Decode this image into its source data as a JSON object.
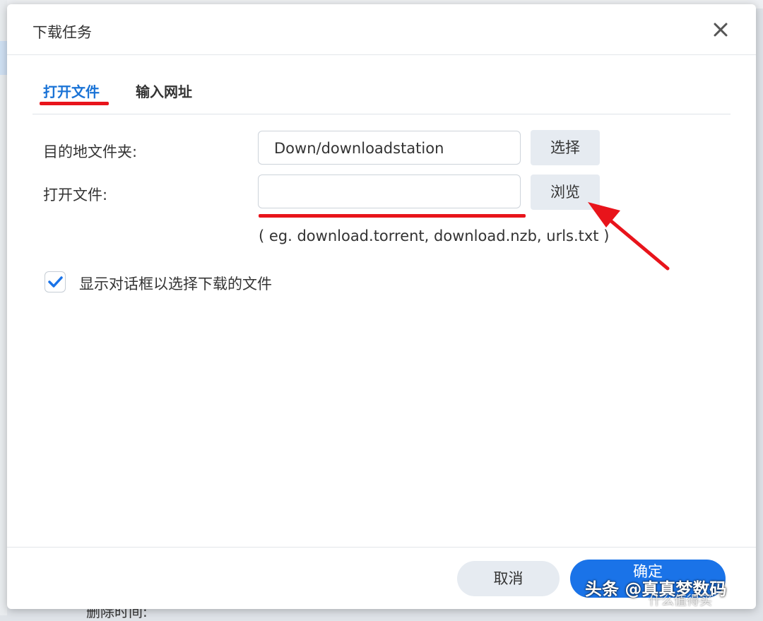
{
  "dialog": {
    "title": "下载任务",
    "close_icon": "close-icon"
  },
  "tabs": [
    {
      "label": "打开文件",
      "active": true
    },
    {
      "label": "输入网址",
      "active": false
    }
  ],
  "form": {
    "destination_label": "目的地文件夹:",
    "destination_value": "Down/downloadstation",
    "select_button": "选择",
    "open_file_label": "打开文件:",
    "open_file_value": "",
    "browse_button": "浏览",
    "hint": "( eg. download.torrent, download.nzb, urls.txt )"
  },
  "checkbox": {
    "label": "显示对话框以选择下载的文件",
    "checked": true
  },
  "footer": {
    "cancel_button": "取消",
    "ok_button": "确定"
  },
  "background": {
    "partial_text": "删除时间:"
  },
  "watermark": {
    "text": "头条 @真真梦数码",
    "sub_text": "什么值得买"
  },
  "colors": {
    "accent": "#1a73e8",
    "annotation_red": "#e8141b"
  }
}
